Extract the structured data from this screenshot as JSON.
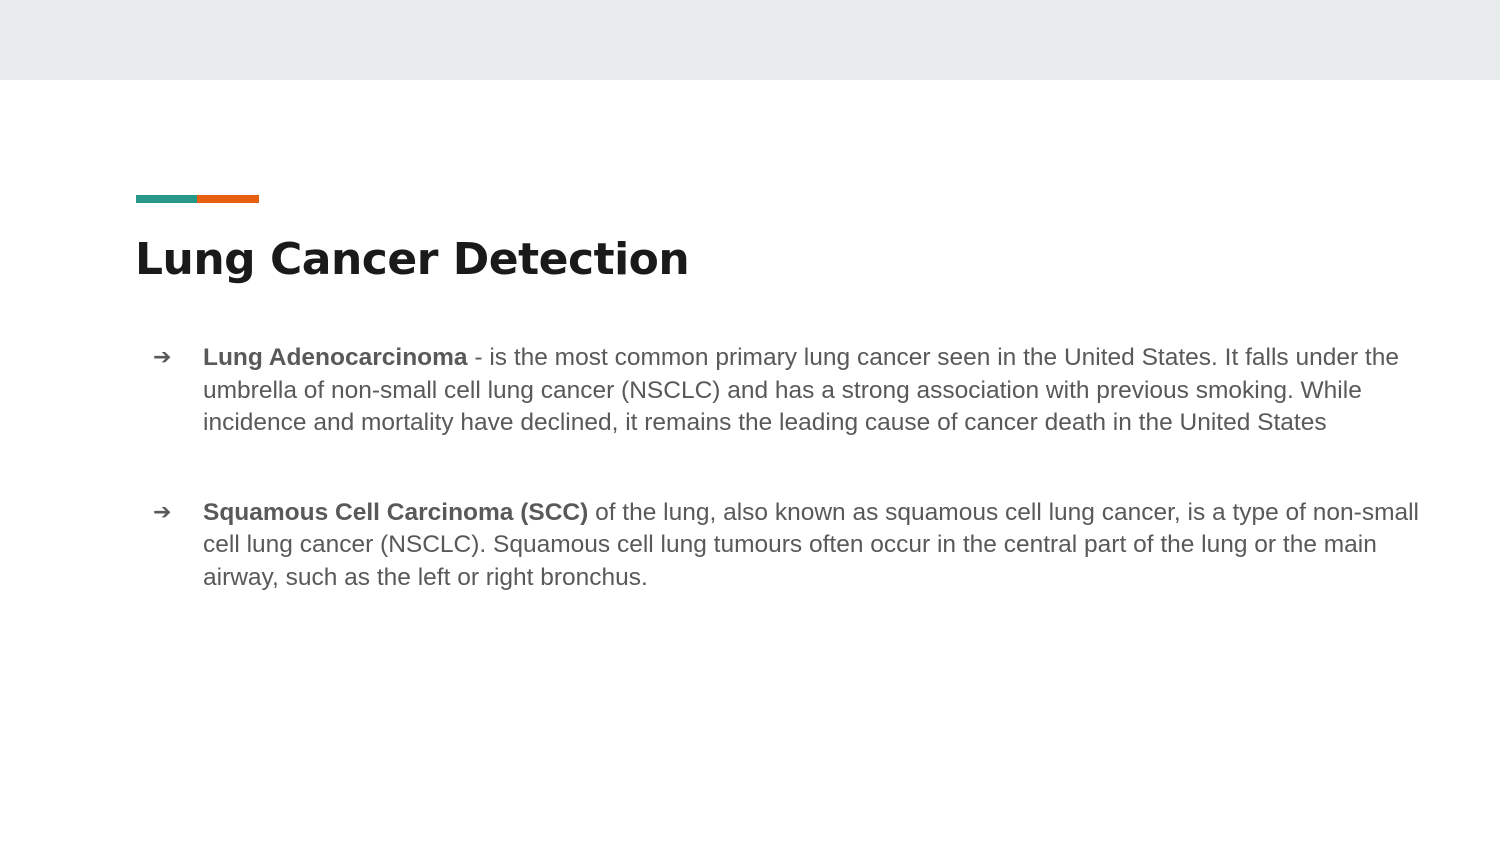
{
  "colors": {
    "top_band": "#e8ebec",
    "accent_teal": "#26998a",
    "accent_orange": "#e8600f",
    "title": "#1a1a1a",
    "body_text": "#595959"
  },
  "slide": {
    "title": "Lung Cancer Detection",
    "bullet_icon": "arrow-right-icon",
    "bullet_glyph": "➔",
    "bullets": [
      {
        "term": "Lung Adenocarcinoma",
        "text": " - is the most common primary lung cancer seen in the United States. It falls under the umbrella of non-small cell lung cancer (NSCLC) and has a strong association with previous smoking. While incidence and mortality have declined, it remains the leading cause of cancer death in the United States"
      },
      {
        "term": "Squamous Cell Carcinoma (SCC)",
        "text": " of the lung, also known as squamous cell lung cancer, is a type of non-small cell lung cancer (NSCLC). Squamous cell lung tumours often occur in the central part of the lung or the main airway, such as the left or right bronchus."
      }
    ]
  }
}
